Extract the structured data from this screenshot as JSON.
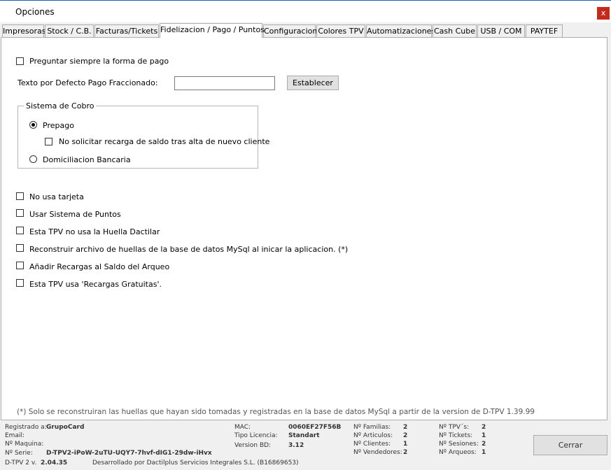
{
  "window": {
    "title": "Opciones",
    "close_label": "x"
  },
  "tabs": [
    {
      "label": "Impresoras"
    },
    {
      "label": "Stock / C.B."
    },
    {
      "label": "Facturas/Tickets"
    },
    {
      "label": "Fidelizacion / Pago / Puntos",
      "active": true
    },
    {
      "label": "Configuracion"
    },
    {
      "label": "Colores TPV"
    },
    {
      "label": "Automatizaciones"
    },
    {
      "label": "Cash Cube"
    },
    {
      "label": "USB / COM"
    },
    {
      "label": "PAYTEF"
    }
  ],
  "payment": {
    "ask_always_label": "Preguntar siempre la forma de pago",
    "ask_always_checked": false,
    "default_text_label": "Texto por Defecto Pago Fraccionado:",
    "default_text_value": "",
    "set_button": "Establecer"
  },
  "billing_system": {
    "legend": "Sistema de Cobro",
    "prepaid_label": "Prepago",
    "prepaid_selected": true,
    "no_recharge_label": "No solicitar recarga de saldo tras alta de nuevo cliente",
    "no_recharge_checked": false,
    "direct_debit_label": "Domiciliacion Bancaria",
    "direct_debit_selected": false
  },
  "options": [
    {
      "label": "No usa tarjeta",
      "checked": false
    },
    {
      "label": "Usar Sistema de Puntos",
      "checked": false
    },
    {
      "label": "Esta TPV no usa la Huella Dactilar",
      "checked": false
    },
    {
      "label": "Reconstruir archivo de huellas de la base de datos MySql al inicar la aplicacion. (*)",
      "checked": false
    },
    {
      "label": "Añadir Recargas al Saldo del Arqueo",
      "checked": false
    },
    {
      "label": "Esta TPV usa 'Recargas Gratuitas'.",
      "checked": false
    }
  ],
  "footnote": "(*) Solo se reconstruiran las huellas que hayan sido tomadas  y registradas en la base de datos MySql  a partir de la version de D-TPV 1.39.99",
  "status": {
    "registered_label": "Registrado a:",
    "registered_value": "GrupoCard",
    "email_label": "Email:",
    "machine_label": "Nº Maquina:",
    "serial_label": "Nº Serie:",
    "serial_value": "D-TPV2-iPoW-2uTU-UQY7-7hvf-dIG1-29dw-iHvx",
    "version_label": "D-TPV 2 v.",
    "version_value": "2.04.35",
    "developer": "Desarrollado por Dactilplus Servicios Integrales S.L. (B16869653)",
    "mac_label": "MAC:",
    "mac_value": "0060EF27F56B",
    "license_label": "Tipo Licencia:",
    "license_value": "Standart",
    "db_version_label": "Version BD:",
    "db_version_value": "3.12",
    "families_label": "Nº Familias:",
    "families_value": "2",
    "articles_label": "Nº Articulos:",
    "articles_value": "2",
    "clients_label": "Nº Clientes:",
    "clients_value": "1",
    "sellers_label": "Nº Vendedores:",
    "sellers_value": "2",
    "tpvs_label": "Nº TPV´s:",
    "tpvs_value": "2",
    "tickets_label": "Nº Tickets:",
    "tickets_value": "1",
    "sessions_label": "Nº Sesiones:",
    "sessions_value": "2",
    "counts_label": "Nº Arqueos:",
    "counts_value": "1",
    "close_button": "Cerrar"
  }
}
